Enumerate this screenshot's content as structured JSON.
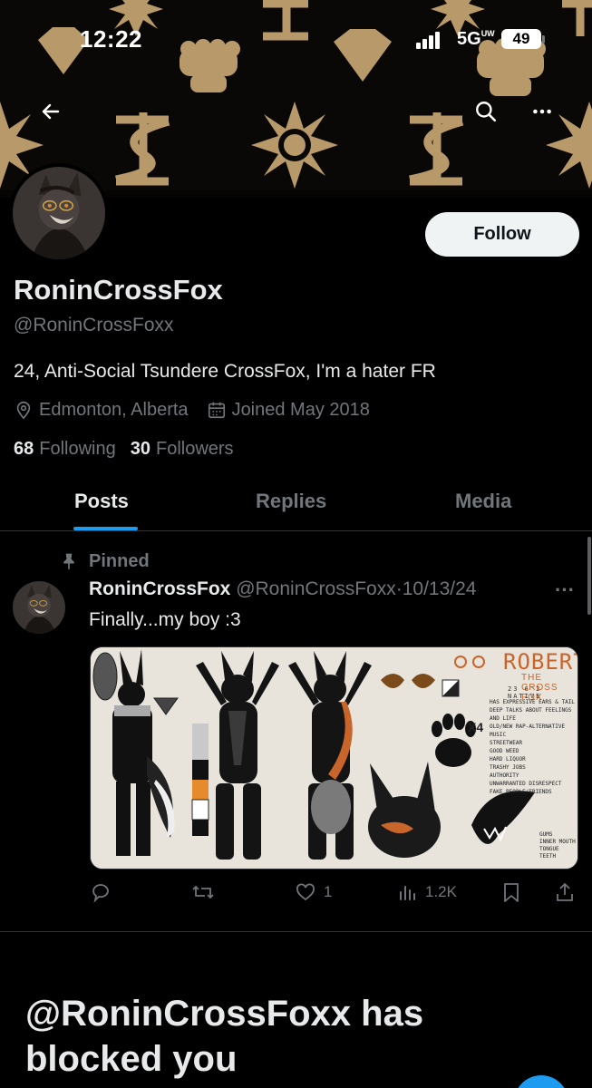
{
  "status_bar": {
    "time": "12:22",
    "network": "5G",
    "network_suffix": "UW",
    "battery": "49"
  },
  "icons": {
    "back": "arrow-left-icon",
    "search": "search-icon",
    "more": "more-horizontal-icon",
    "location": "location-pin-icon",
    "calendar": "calendar-icon",
    "pin": "pin-icon",
    "reply": "reply-icon",
    "repost": "repost-icon",
    "like": "heart-icon",
    "views": "views-chart-icon",
    "bookmark": "bookmark-icon",
    "share": "share-icon"
  },
  "colors": {
    "accent": "#1d9bf0",
    "banner_gold": "#b89a6a",
    "text_secondary": "#71767b"
  },
  "profile": {
    "follow_label": "Follow",
    "display_name": "RoninCrossFox",
    "handle": "@RoninCrossFoxx",
    "bio": "24, Anti-Social Tsundere CrossFox, I'm a hater FR",
    "location": "Edmonton, Alberta",
    "joined": "Joined May 2018",
    "following_count": "68",
    "following_label": "Following",
    "followers_count": "30",
    "followers_label": "Followers"
  },
  "tabs": [
    {
      "label": "Posts",
      "active": true
    },
    {
      "label": "Replies",
      "active": false
    },
    {
      "label": "Media",
      "active": false
    }
  ],
  "post": {
    "pinned_label": "Pinned",
    "author_name": "RoninCrossFox",
    "author_handle": "@RoninCrossFoxx",
    "separator": "·",
    "date": "10/13/24",
    "more": "···",
    "text": "Finally...my boy :3",
    "image": {
      "title": "ROBERT",
      "subtitle": "THE CROSS FOX",
      "stats": "23   6'2   NATIVE",
      "multiplier": "X4",
      "traits": [
        "HAS EXPRESSIVE EARS & TAIL",
        "DEEP TALKS ABOUT FEELINGS AND LIFE",
        "OLD/NEW RAP-ALTERNATIVE MUSIC",
        "STREETWEAR",
        "GOOD WEED",
        "HARD LIQUOR",
        "TRASHY JOBS",
        "AUTHORITY",
        "UNWARRANTED DISRESPECT",
        "FAKE PEOPLE/FRIENDS"
      ],
      "mouth_labels": [
        "GUMS",
        "INNER MOUTH",
        "TONGUE",
        "TEETH"
      ]
    },
    "actions": {
      "reply": "",
      "repost": "",
      "likes": "1",
      "views": "1.2K"
    }
  },
  "blocked_message": "@RoninCrossFoxx has blocked you"
}
